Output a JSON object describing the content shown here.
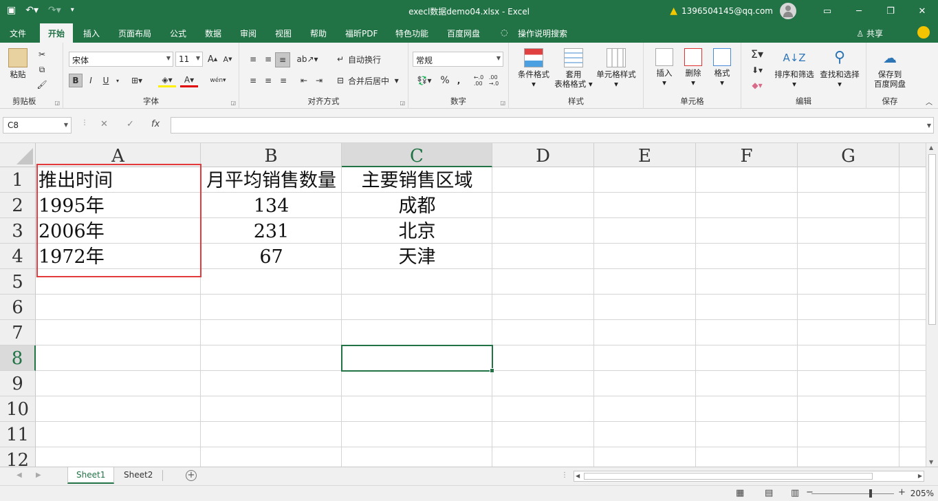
{
  "titlebar": {
    "title": "execl数据demo04.xlsx  -  Excel",
    "user": "1396504145@qq.com",
    "accent": "#217346"
  },
  "tabs": [
    "文件",
    "开始",
    "插入",
    "页面布局",
    "公式",
    "数据",
    "审阅",
    "视图",
    "帮助",
    "福昕PDF",
    "特色功能",
    "百度网盘",
    "操作说明搜索"
  ],
  "share": "共享",
  "ribbon": {
    "clipboard": {
      "label": "剪贴板",
      "paste": "粘贴"
    },
    "font": {
      "label": "字体",
      "name": "宋体",
      "size": "11",
      "bold": "B",
      "italic": "I",
      "underline": "U",
      "fontcolor": "A",
      "wen": "wén"
    },
    "align": {
      "label": "对齐方式",
      "wrap": "自动换行",
      "merge": "合并后居中"
    },
    "number": {
      "label": "数字",
      "format": "常规",
      "percent": "%"
    },
    "styles": {
      "label": "样式",
      "cond": "条件格式",
      "table_line1": "套用",
      "table_line2": "表格格式",
      "cell": "单元格样式"
    },
    "cells": {
      "label": "单元格",
      "insert": "插入",
      "delete": "删除",
      "format": "格式"
    },
    "edit": {
      "label": "编辑",
      "sort": "排序和筛选",
      "find": "查找和选择"
    },
    "save": {
      "label": "保存",
      "line1": "保存到",
      "line2": "百度网盘"
    }
  },
  "namebox": "C8",
  "formula_buttons": {
    "cancel": "✕",
    "enter": "✓",
    "fx": "fx"
  },
  "columns": [
    "A",
    "B",
    "C",
    "D",
    "E",
    "F",
    "G"
  ],
  "rows": [
    "1",
    "2",
    "3",
    "4",
    "5",
    "6",
    "7",
    "8",
    "9",
    "10",
    "11",
    "12"
  ],
  "cells": {
    "A1": "推出时间",
    "B1": "月平均销售数量",
    "C1": "主要销售区域",
    "A2": "1995年",
    "B2": "134",
    "C2": "成都",
    "A3": "2006年",
    "B3": "231",
    "C3": "北京",
    "A4": "1972年",
    "B4": "67",
    "C4": "天津"
  },
  "sheets": [
    "Sheet1",
    "Sheet2"
  ],
  "zoom": "205%"
}
